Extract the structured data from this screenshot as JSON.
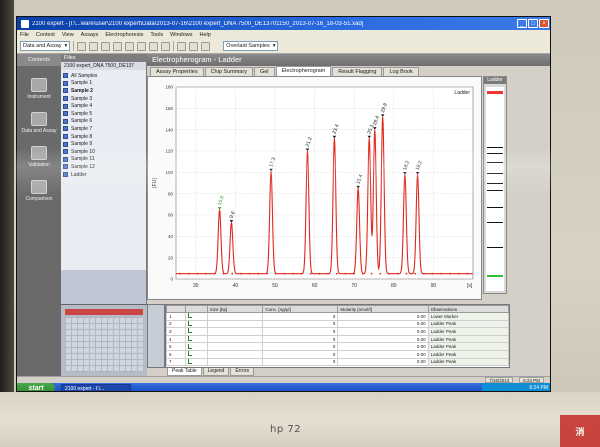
{
  "window": {
    "title": "2100 expert - [I:\\...ware\\user\\2100 expert\\Data\\2013-07-16\\2100 expert_DNA 7500_DE13701150_2013-07-16_18-03-51.xad]"
  },
  "menu": [
    "File",
    "Context",
    "View",
    "Assays",
    "Electrophoresis",
    "Tools",
    "Windows",
    "Help"
  ],
  "toolbar": {
    "context_select": "Data and Assay",
    "overlaid_label": "Overlaid Samples"
  },
  "leftnav": {
    "header": "Contents",
    "items": [
      "Instrument",
      "Data and Assay",
      "Validation",
      "Comparison"
    ]
  },
  "tree": {
    "header": "Files",
    "file": "2100 expert_DNA 7500_DE137",
    "items": [
      "All Samples",
      "Sample 1",
      "Sample 2",
      "Sample 3",
      "Sample 4",
      "Sample 5",
      "Sample 6",
      "Sample 7",
      "Sample 8",
      "Sample 9",
      "Sample 10",
      "Sample 11",
      "Sample 12",
      "Ladder"
    ]
  },
  "main": {
    "header": "Electropherogram - Ladder",
    "tabs": [
      "Assay Properties",
      "Chip Summary",
      "Gel",
      "Electropherogram",
      "Result Flagging",
      "Log Book"
    ],
    "active_tab": "Electropherogram"
  },
  "ladder": {
    "label": "Ladder"
  },
  "chart_data": {
    "type": "line",
    "title": "",
    "legend_label": "Ladder",
    "xlabel": "[s]",
    "ylabel": "[FU]",
    "xlim": [
      25,
      100
    ],
    "ylim": [
      0,
      180
    ],
    "xticks": [
      30,
      40,
      50,
      60,
      70,
      80,
      90
    ],
    "yticks": [
      0,
      20,
      40,
      60,
      80,
      100,
      120,
      140,
      160,
      180
    ],
    "baseline": 5,
    "peaks": [
      {
        "x": 36.0,
        "y": 65,
        "label": "15.0"
      },
      {
        "x": 39.0,
        "y": 53,
        "label": "9.6"
      },
      {
        "x": 49.0,
        "y": 101,
        "label": "17.3"
      },
      {
        "x": 58.2,
        "y": 120,
        "label": "21.2"
      },
      {
        "x": 65.0,
        "y": 132,
        "label": "23.4"
      },
      {
        "x": 71.0,
        "y": 85,
        "label": "15.4"
      },
      {
        "x": 73.8,
        "y": 132,
        "label": "25.1"
      },
      {
        "x": 75.2,
        "y": 140,
        "label": "28.4"
      },
      {
        "x": 77.2,
        "y": 152,
        "label": "29.8"
      },
      {
        "x": 82.8,
        "y": 98,
        "label": "18.2"
      },
      {
        "x": 86.0,
        "y": 98,
        "label": "18.2"
      }
    ]
  },
  "table": {
    "columns": [
      "Size [bp]",
      "Conc. [ng/µl]",
      "Molarity [nmol/l]",
      "Observations"
    ],
    "rows": [
      {
        "idx": "1",
        "size": "",
        "conc": "0",
        "molarity": "0.00",
        "obs": "Lower Marker"
      },
      {
        "idx": "2",
        "size": "",
        "conc": "0",
        "molarity": "0.00",
        "obs": "Ladder Peak"
      },
      {
        "idx": "3",
        "size": "",
        "conc": "0",
        "molarity": "0.00",
        "obs": "Ladder Peak"
      },
      {
        "idx": "4",
        "size": "",
        "conc": "0",
        "molarity": "0.00",
        "obs": "Ladder Peak"
      },
      {
        "idx": "5",
        "size": "",
        "conc": "0",
        "molarity": "0.00",
        "obs": "Ladder Peak"
      },
      {
        "idx": "6",
        "size": "",
        "conc": "0",
        "molarity": "0.00",
        "obs": "Ladder Peak"
      },
      {
        "idx": "7",
        "size": "",
        "conc": "0",
        "molarity": "0.00",
        "obs": "Ladder Peak"
      }
    ],
    "subtabs": [
      "Peak Table",
      "Legend",
      "Errors"
    ]
  },
  "statusbar": {
    "date": "7/16/2013",
    "time": "6:24 PM"
  },
  "taskbar": {
    "start": "start",
    "task": "2100 expert - I:\\...",
    "clock": "6:24 PM"
  },
  "bezel": {
    "brand": "hp 72",
    "sticker": "消"
  }
}
